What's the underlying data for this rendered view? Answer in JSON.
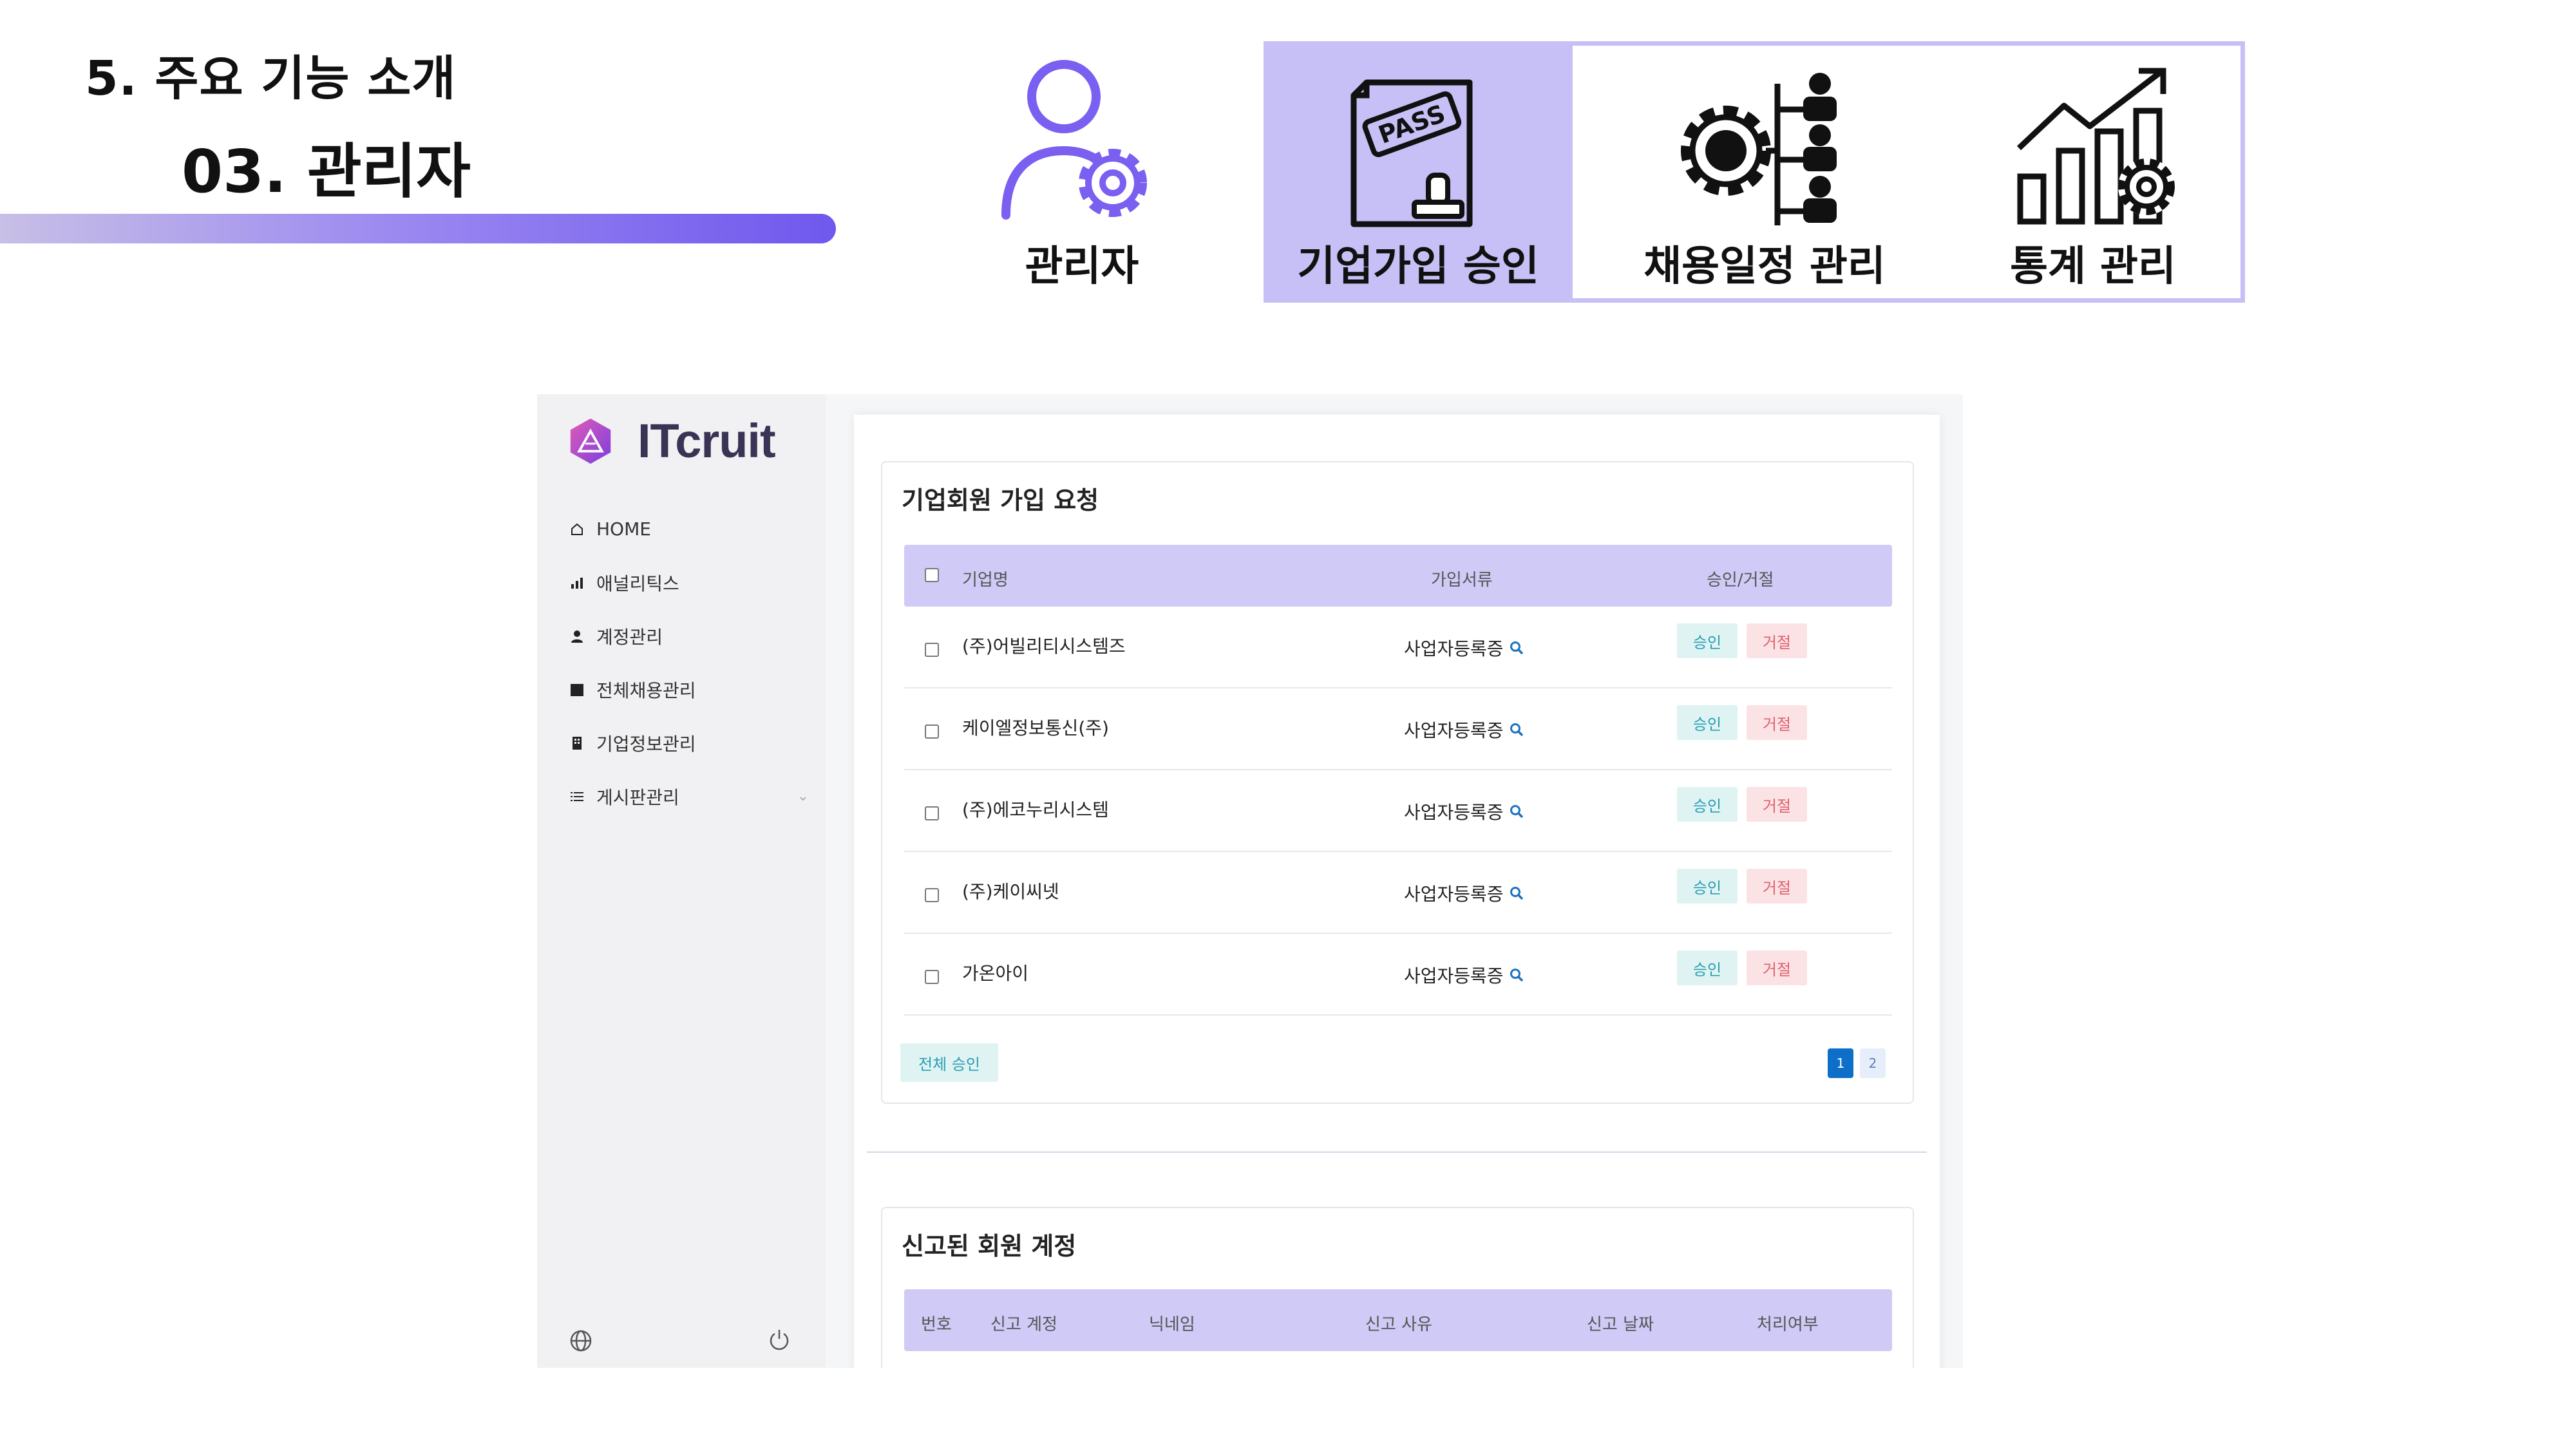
{
  "slide": {
    "heading": "5. 주요 기능 소개",
    "subheading": "03. 관리자"
  },
  "features": [
    {
      "label": "관리자",
      "icon": "admin-gear-icon",
      "active": false
    },
    {
      "label": "기업가입 승인",
      "icon": "pass-stamp-icon",
      "active": true
    },
    {
      "label": "채용일정 관리",
      "icon": "schedule-gear-icon",
      "active": false
    },
    {
      "label": "통계 관리",
      "icon": "stats-chart-icon",
      "active": false
    }
  ],
  "colors": {
    "accent": "#6f58ee",
    "feature_highlight": "#c7c0f7",
    "table_header": "#cfcaf6",
    "approve": "#2a9fb3",
    "reject": "#e0606d",
    "page_active": "#0d6fc9"
  },
  "app": {
    "brand": "ITcruit",
    "nav": [
      {
        "label": "HOME",
        "icon": "home-icon"
      },
      {
        "label": "애널리틱스",
        "icon": "bar-chart-icon"
      },
      {
        "label": "계정관리",
        "icon": "user-icon"
      },
      {
        "label": "전체채용관리",
        "icon": "calendar-icon"
      },
      {
        "label": "기업정보관리",
        "icon": "building-icon"
      },
      {
        "label": "게시판관리",
        "icon": "list-icon"
      }
    ],
    "signup_requests": {
      "title": "기업회원 가입 요청",
      "columns": [
        "기업명",
        "가입서류",
        "승인/거절"
      ],
      "rows": [
        {
          "company": "(주)어빌리티시스템즈",
          "document": "사업자등록증",
          "approve": "승인",
          "reject": "거절"
        },
        {
          "company": "케이엘정보통신(주)",
          "document": "사업자등록증",
          "approve": "승인",
          "reject": "거절"
        },
        {
          "company": "(주)에코누리시스템",
          "document": "사업자등록증",
          "approve": "승인",
          "reject": "거절"
        },
        {
          "company": "(주)케이씨넷",
          "document": "사업자등록증",
          "approve": "승인",
          "reject": "거절"
        },
        {
          "company": "가온아이",
          "document": "사업자등록증",
          "approve": "승인",
          "reject": "거절"
        }
      ],
      "approve_all": "전체 승인",
      "pages": [
        "1",
        "2"
      ],
      "current_page": "1"
    },
    "reported_accounts": {
      "title": "신고된 회원 계정",
      "columns": [
        "번호",
        "신고 계정",
        "닉네임",
        "신고 사유",
        "신고 날짜",
        "처리여부"
      ]
    }
  }
}
